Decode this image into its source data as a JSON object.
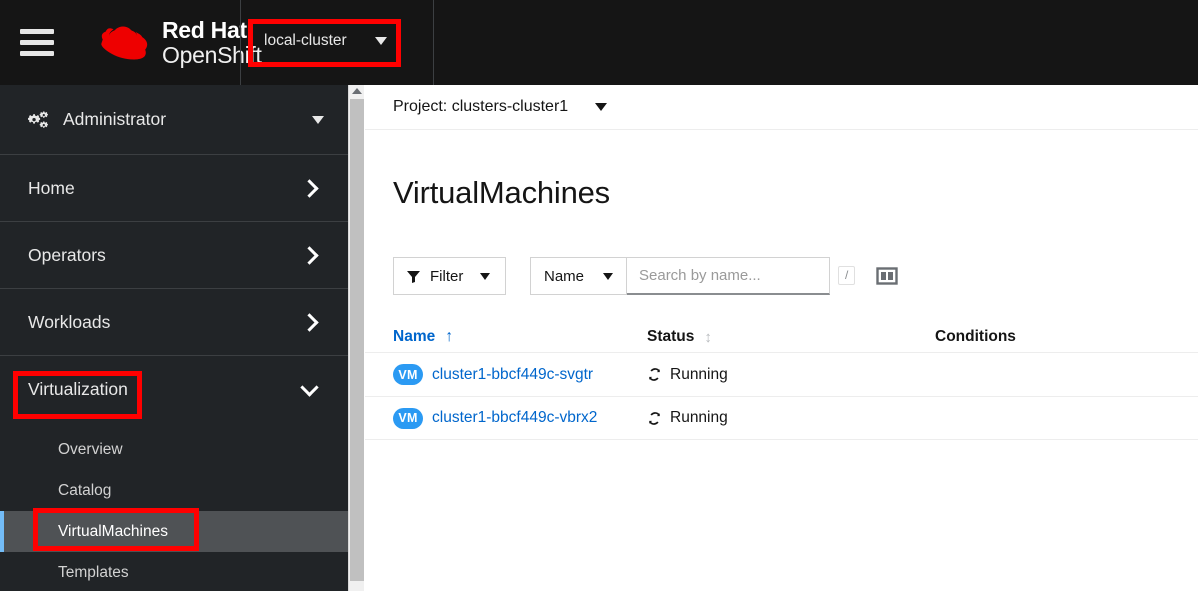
{
  "masthead": {
    "menu_icon": "hamburger-icon",
    "brand_top": "Red Hat",
    "brand_bottom": "OpenShift",
    "cluster_selector": "local-cluster"
  },
  "sidebar": {
    "perspective": {
      "label": "Administrator",
      "icon": "cogs-icon"
    },
    "sections": [
      {
        "label": "Home",
        "expanded": false
      },
      {
        "label": "Operators",
        "expanded": false
      },
      {
        "label": "Workloads",
        "expanded": false
      },
      {
        "label": "Virtualization",
        "expanded": true
      }
    ],
    "virtualization_items": [
      {
        "label": "Overview",
        "active": false
      },
      {
        "label": "Catalog",
        "active": false
      },
      {
        "label": "VirtualMachines",
        "active": true
      },
      {
        "label": "Templates",
        "active": false
      }
    ]
  },
  "main": {
    "project": "Project: clusters-cluster1",
    "page_title": "VirtualMachines",
    "toolbar": {
      "filter_label": "Filter",
      "attribute_label": "Name",
      "search_placeholder": "Search by name...",
      "search_value": "",
      "search_shortcut": "/",
      "column_management_icon": "column-management-icon"
    },
    "table": {
      "columns": [
        {
          "label": "Name",
          "sort": "asc"
        },
        {
          "label": "Status",
          "sort": "none"
        },
        {
          "label": "Conditions",
          "sort": "none"
        }
      ],
      "rows": [
        {
          "badge": "VM",
          "name": "cluster1-bbcf449c-svgtr",
          "status": "Running",
          "conditions": ""
        },
        {
          "badge": "VM",
          "name": "cluster1-bbcf449c-vbrx2",
          "status": "Running",
          "conditions": ""
        }
      ]
    }
  },
  "annotations": {
    "color": "#ff0000",
    "boxes": [
      "cluster-selector",
      "virtualization-nav",
      "virtualmachines-nav"
    ]
  },
  "colors": {
    "masthead_bg": "#151515",
    "sidebar_bg": "#212427",
    "active_item_bg": "#4f5255",
    "accent_blue": "#73bcf7",
    "link_blue": "#0066cc",
    "badge_blue": "#2b9af3",
    "highlight_red": "#ff0000"
  }
}
